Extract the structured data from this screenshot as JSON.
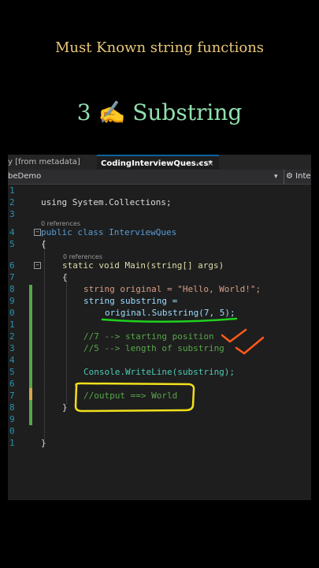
{
  "heading": "Must Known string functions",
  "subheading": {
    "number": "3",
    "emoji": "✍",
    "label": "Substring"
  },
  "tabs": [
    {
      "label": "y [from metadata]"
    },
    {
      "label": "CodingInterviewQues.cs*",
      "pin": "⊸",
      "close": "×"
    }
  ],
  "navbar": {
    "left": "beDemo",
    "dropdown": "▾",
    "right_icon": "⚙",
    "right": "Inter"
  },
  "code_lines": [
    {
      "num": "1",
      "code": ""
    },
    {
      "num": "2",
      "code": "using System.Collections;"
    },
    {
      "num": "3",
      "code": ""
    },
    {
      "num": "",
      "refs": "0 references"
    },
    {
      "num": "4",
      "code": "public class InterviewQues"
    },
    {
      "num": "5",
      "code": "{"
    },
    {
      "num": "",
      "refs": "0 references"
    },
    {
      "num": "6",
      "code": "static void Main(string[] args)"
    },
    {
      "num": "7",
      "code": "{"
    },
    {
      "num": "8",
      "code": "string original = \"Hello, World!\";"
    },
    {
      "num": "9",
      "code": "string substring ="
    },
    {
      "num": "0",
      "code": "original.Substring(7, 5);"
    },
    {
      "num": "1",
      "code": ""
    },
    {
      "num": "2",
      "code": "//7 --> starting position"
    },
    {
      "num": "3",
      "code": "//5 --> length of substring"
    },
    {
      "num": "4",
      "code": ""
    },
    {
      "num": "5",
      "code": "Console.WriteLine(substring);"
    },
    {
      "num": "6",
      "code": ""
    },
    {
      "num": "7",
      "code": "//output ==> World"
    },
    {
      "num": "8",
      "code": "}"
    },
    {
      "num": "9",
      "code": ""
    },
    {
      "num": "0",
      "code": ""
    },
    {
      "num": "1",
      "code": "}"
    }
  ],
  "annotation_colors": {
    "underline": "#1fd01f",
    "checkmark": "#ff5a1a",
    "highlight_box": "#f2e01a"
  }
}
